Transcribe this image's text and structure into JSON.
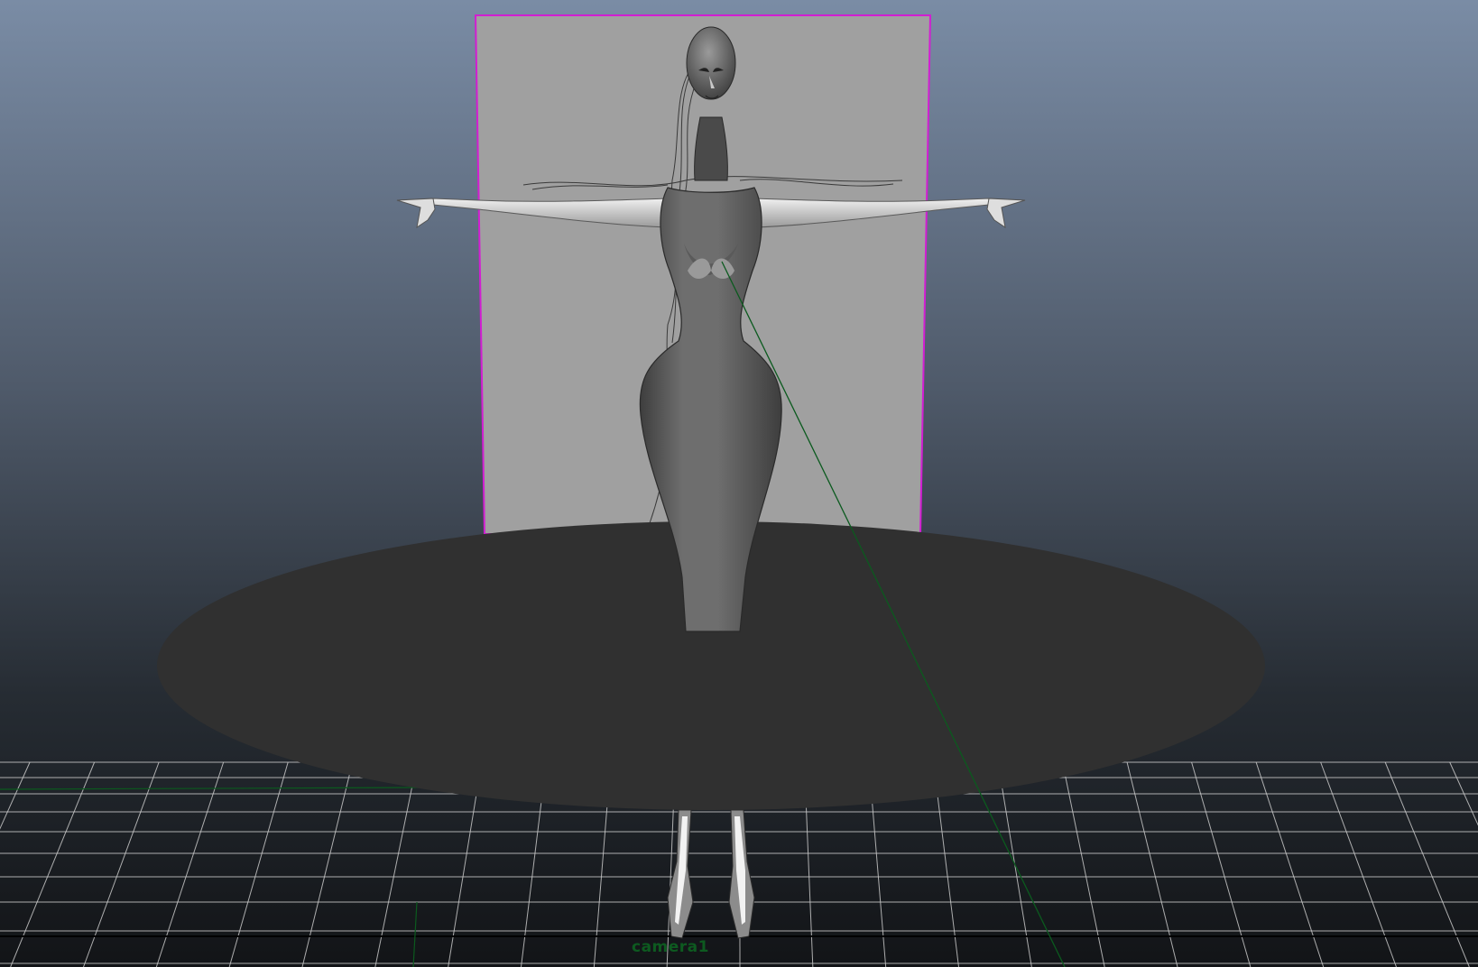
{
  "viewport": {
    "camera_name": "camera1",
    "background_gradient": [
      "#7a8ca5",
      "#4f5a6a",
      "#262c33",
      "#121417"
    ],
    "colors": {
      "backdrop_plane": "#a0a0a0",
      "selection_outline": "#d21ed2",
      "ground_disc": "#303030",
      "grid": "#c8c8c8",
      "axis": "#0b5a1e",
      "camera_label": "#0d5a20",
      "body_mid": "#6e6e6e",
      "body_dark": "#3e3e3e",
      "arm_light": "#dcdcdc"
    }
  }
}
